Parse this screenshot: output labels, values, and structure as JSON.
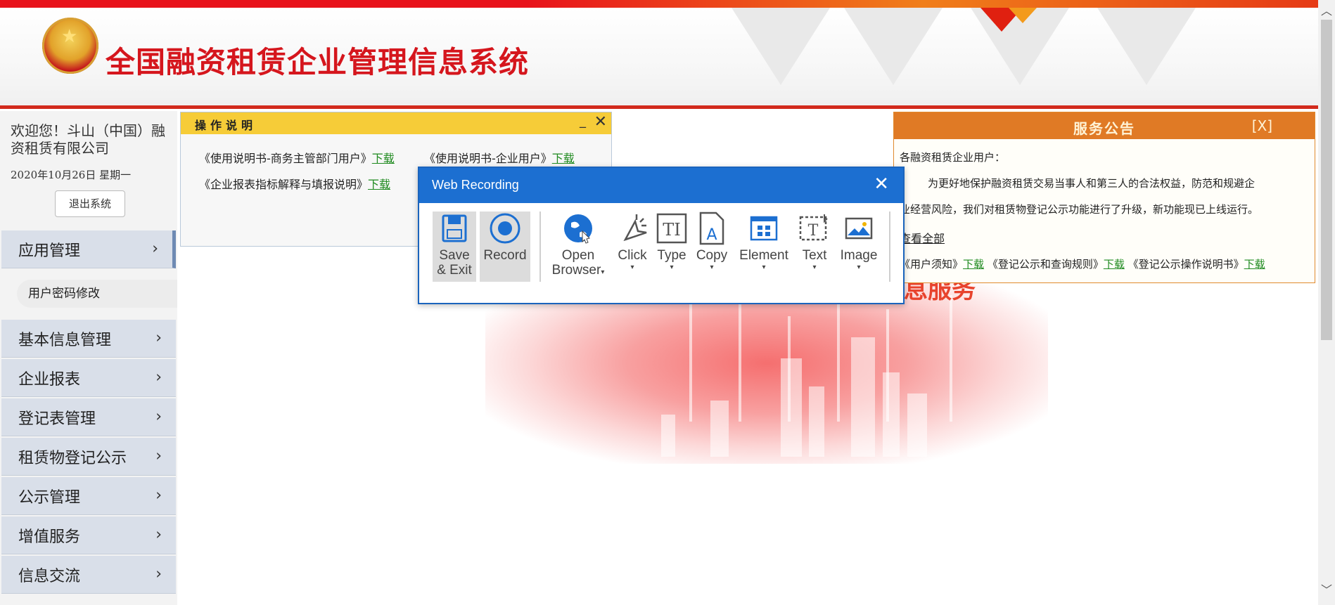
{
  "header": {
    "title": "全国融资租赁企业管理信息系统"
  },
  "sidebar": {
    "welcome": "欢迎您！斗山（中国）融资租赁有限公司",
    "date": "2020年10月26日  星期一",
    "logout": "退出系统",
    "items": [
      {
        "label": "应用管理"
      },
      {
        "label": "基本信息管理"
      },
      {
        "label": "企业报表"
      },
      {
        "label": "登记表管理"
      },
      {
        "label": "租赁物登记公示"
      },
      {
        "label": "公示管理"
      },
      {
        "label": "增值服务"
      },
      {
        "label": "信息交流"
      }
    ],
    "submenu": {
      "label": "用户密码修改"
    }
  },
  "instructions": {
    "title": "操作说明",
    "minimize": "_",
    "close": "✕",
    "line1a": "《使用说明书-商务主管部门用户》",
    "line1b": "《使用说明书-企业用户》",
    "line2": "《企业报表指标解释与填报说明》",
    "download": "下载"
  },
  "notice": {
    "title": "服务公告",
    "close": "[X]",
    "greeting": "各融资租赁企业用户：",
    "body1": "为更好地保护融资租赁交易当事人和第三人的合法权益，防范和规避企",
    "body2": "业经营风险，我们对租赁物登记公示功能进行了升级，新功能现已上线运行。",
    "view_all": "查看全部",
    "doc1": "《用户须知》",
    "doc2": "《登记公示和查询规则》",
    "doc3": "《登记公示操作说明书》",
    "download": "下载"
  },
  "background": {
    "art_text": "息服务"
  },
  "recorder": {
    "title": "Web Recording",
    "close": "✕",
    "tools": {
      "save": [
        "Save",
        "& Exit"
      ],
      "record": "Record",
      "open": [
        "Open",
        "Browser"
      ],
      "click": "Click",
      "type": "Type",
      "copy": "Copy",
      "element": "Element",
      "text": "Text",
      "image": "Image"
    }
  },
  "colors": {
    "brand_red": "#d5161d",
    "accent_blue": "#1c6fd1",
    "notice_orange": "#e07a25",
    "instr_yellow": "#f6cc38"
  }
}
